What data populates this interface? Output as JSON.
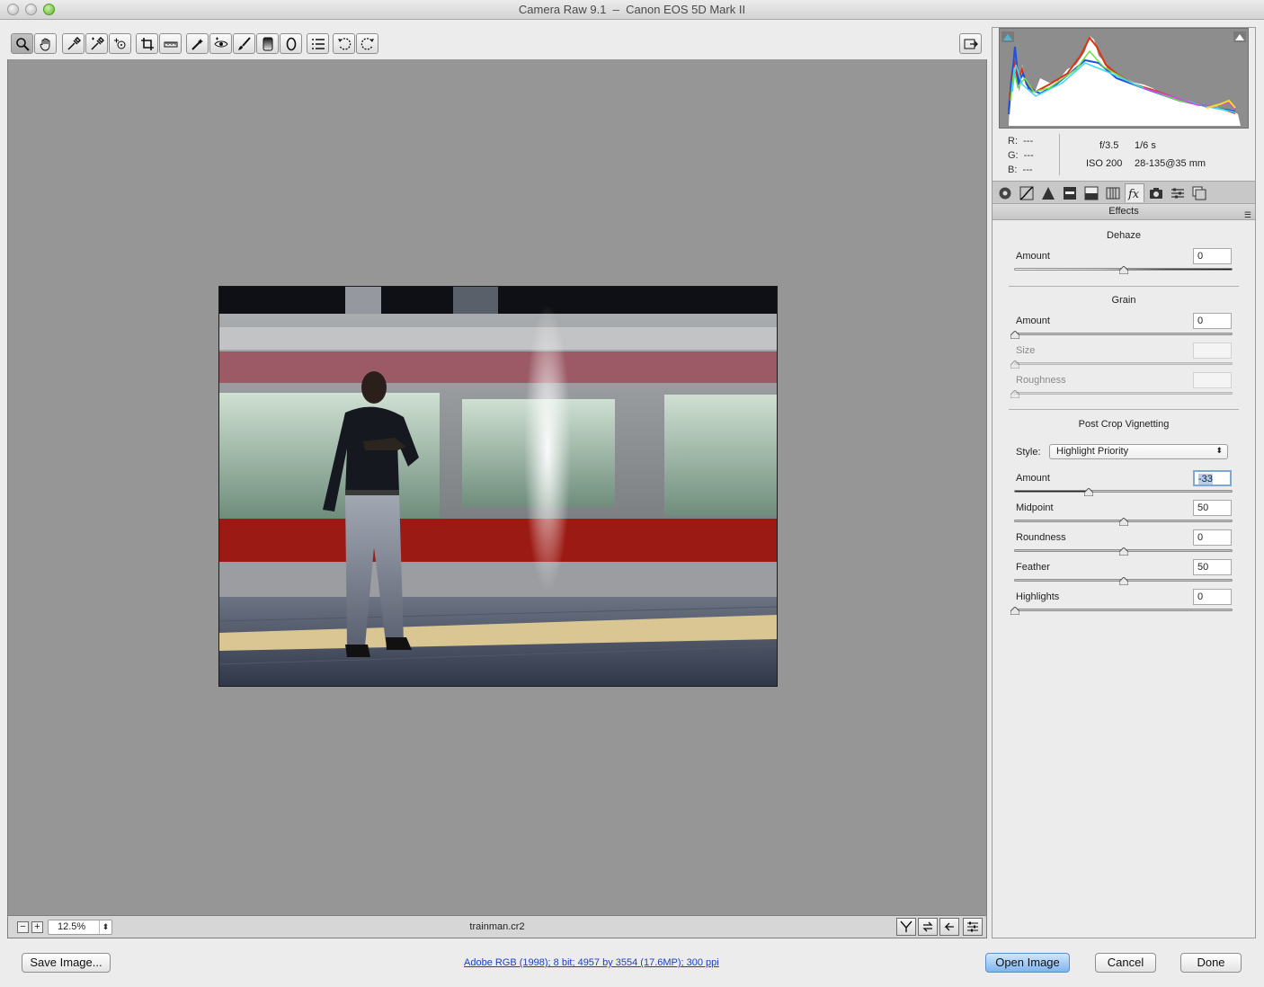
{
  "window": {
    "title": "Camera Raw 9.1  –  Canon EOS 5D Mark II"
  },
  "toolbar": {
    "tools": [
      {
        "name": "zoom-tool",
        "icon": "zoom-icon"
      },
      {
        "name": "hand-tool",
        "icon": "hand-icon"
      },
      {
        "name": "white-balance-tool",
        "icon": "eyedropper-icon"
      },
      {
        "name": "color-sampler-tool",
        "icon": "color-sampler-icon"
      },
      {
        "name": "targeted-adjustment-tool",
        "icon": "target-adjust-icon"
      },
      {
        "name": "crop-tool",
        "icon": "crop-icon"
      },
      {
        "name": "straighten-tool",
        "icon": "straighten-icon"
      },
      {
        "name": "spot-removal-tool",
        "icon": "spot-removal-icon"
      },
      {
        "name": "red-eye-tool",
        "icon": "red-eye-icon"
      },
      {
        "name": "adjustment-brush-tool",
        "icon": "brush-icon"
      },
      {
        "name": "graduated-filter-tool",
        "icon": "graduated-filter-icon"
      },
      {
        "name": "radial-filter-tool",
        "icon": "radial-filter-icon"
      },
      {
        "name": "preferences-tool",
        "icon": "list-icon"
      },
      {
        "name": "rotate-left-tool",
        "icon": "rotate-left-icon"
      },
      {
        "name": "rotate-right-tool",
        "icon": "rotate-right-icon"
      }
    ]
  },
  "status": {
    "zoom": "12.5%",
    "filename": "trainman.cr2"
  },
  "info": {
    "r_label": "R:",
    "r_value": "---",
    "g_label": "G:",
    "g_value": "---",
    "b_label": "B:",
    "b_value": "---",
    "aperture": "f/3.5",
    "shutter": "1/6 s",
    "iso": "ISO 200",
    "lens": "28-135@35 mm"
  },
  "panel": {
    "section_title": "Effects",
    "dehaze": {
      "title": "Dehaze",
      "amount_label": "Amount",
      "amount_value": "0"
    },
    "grain": {
      "title": "Grain",
      "amount_label": "Amount",
      "amount_value": "0",
      "size_label": "Size",
      "size_value": "",
      "roughness_label": "Roughness",
      "roughness_value": ""
    },
    "vignette": {
      "title": "Post Crop Vignetting",
      "style_label": "Style:",
      "style_value": "Highlight Priority",
      "amount_label": "Amount",
      "amount_value": "-33",
      "midpoint_label": "Midpoint",
      "midpoint_value": "50",
      "roundness_label": "Roundness",
      "roundness_value": "0",
      "feather_label": "Feather",
      "feather_value": "50",
      "highlights_label": "Highlights",
      "highlights_value": "0"
    }
  },
  "footer": {
    "save_label": "Save Image...",
    "workflow_link": "Adobe RGB (1998); 8 bit; 4957 by 3554 (17.6MP); 300 ppi",
    "open_label": "Open Image",
    "cancel_label": "Cancel",
    "done_label": "Done"
  },
  "colors": {
    "preview_bg": "#969696",
    "accent": "#7fb5ee",
    "link": "#1c3fbf"
  }
}
